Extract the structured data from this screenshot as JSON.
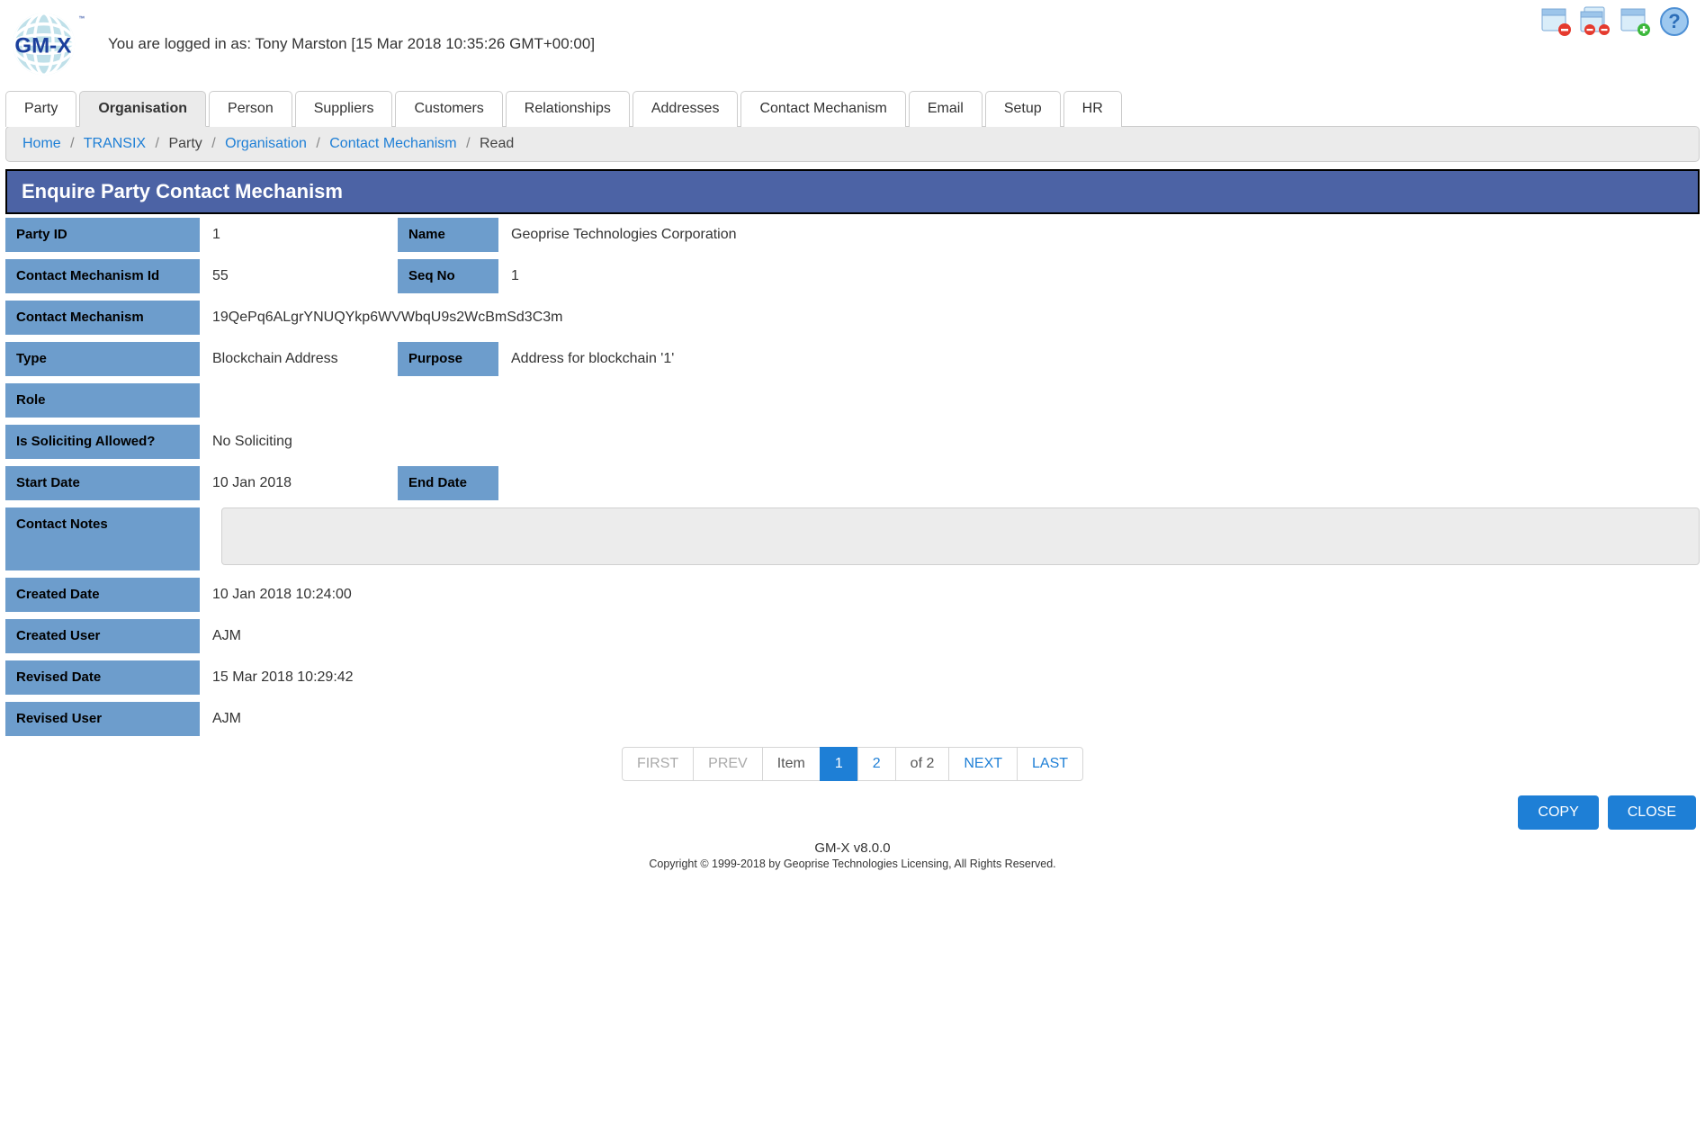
{
  "header": {
    "logo_text": "GM-X",
    "logo_tm": "™",
    "login_prefix": "You are logged in as: ",
    "login_user": "Tony Marston",
    "login_timestamp": "[15 Mar 2018 10:35:26 GMT+00:00]"
  },
  "header_icons": {
    "a": "page-remove-icon",
    "b": "pages-remove-icon",
    "c": "page-add-icon",
    "d": "help-icon"
  },
  "tabs": [
    {
      "label": "Party"
    },
    {
      "label": "Organisation"
    },
    {
      "label": "Person"
    },
    {
      "label": "Suppliers"
    },
    {
      "label": "Customers"
    },
    {
      "label": "Relationships"
    },
    {
      "label": "Addresses"
    },
    {
      "label": "Contact Mechanism"
    },
    {
      "label": "Email"
    },
    {
      "label": "Setup"
    },
    {
      "label": "HR"
    }
  ],
  "active_tab_index": 1,
  "breadcrumb": [
    {
      "label": "Home",
      "link": true
    },
    {
      "label": "TRANSIX",
      "link": true
    },
    {
      "label": "Party",
      "link": false
    },
    {
      "label": "Organisation",
      "link": true
    },
    {
      "label": "Contact Mechanism",
      "link": true
    },
    {
      "label": "Read",
      "link": false
    }
  ],
  "page_title": "Enquire Party Contact Mechanism",
  "fields": {
    "party_id": {
      "label": "Party ID",
      "value": "1"
    },
    "name": {
      "label": "Name",
      "value": "Geoprise Technologies Corporation"
    },
    "cm_id": {
      "label": "Contact Mechanism Id",
      "value": "55"
    },
    "seq_no": {
      "label": "Seq No",
      "value": "1"
    },
    "cm": {
      "label": "Contact Mechanism",
      "value": "19QePq6ALgrYNUQYkp6WVWbqU9s2WcBmSd3C3m"
    },
    "type": {
      "label": "Type",
      "value": "Blockchain Address"
    },
    "purpose": {
      "label": "Purpose",
      "value": "Address for blockchain '1'"
    },
    "role": {
      "label": "Role",
      "value": ""
    },
    "soliciting": {
      "label": "Is Soliciting Allowed?",
      "value": "No Soliciting"
    },
    "start_date": {
      "label": "Start Date",
      "value": "10 Jan 2018"
    },
    "end_date": {
      "label": "End Date",
      "value": ""
    },
    "notes": {
      "label": "Contact Notes",
      "value": ""
    },
    "created_date": {
      "label": "Created Date",
      "value": "10 Jan 2018 10:24:00"
    },
    "created_user": {
      "label": "Created User",
      "value": "AJM"
    },
    "revised_date": {
      "label": "Revised Date",
      "value": "15 Mar 2018 10:29:42"
    },
    "revised_user": {
      "label": "Revised User",
      "value": "AJM"
    }
  },
  "pagination": {
    "first": "FIRST",
    "prev": "PREV",
    "item": "Item",
    "page1": "1",
    "page2": "2",
    "of": "of 2",
    "next": "NEXT",
    "last": "LAST"
  },
  "actions": {
    "copy": "COPY",
    "close": "CLOSE"
  },
  "footer": {
    "version": "GM-X v8.0.0",
    "copyright": "Copyright © 1999-2018 by Geoprise Technologies Licensing, All Rights Reserved."
  }
}
